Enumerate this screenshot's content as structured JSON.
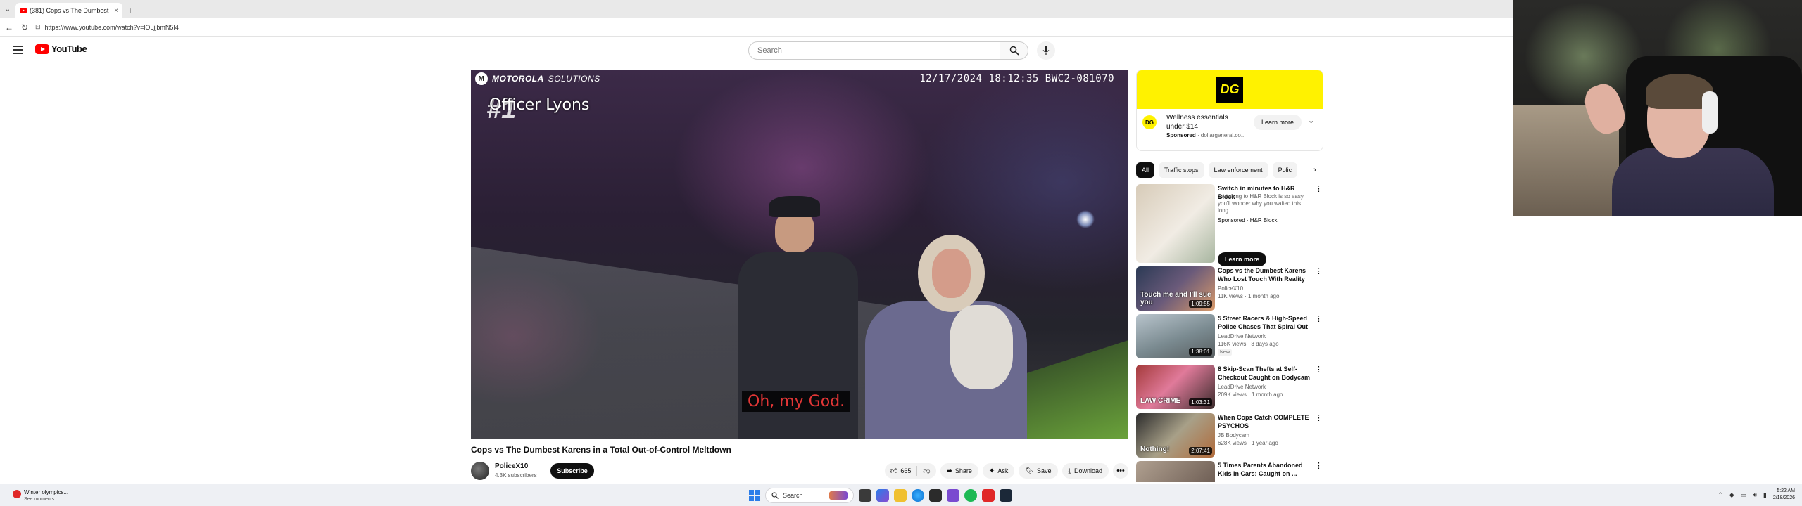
{
  "browser": {
    "tab_title": "(381) Cops vs The Dumbest K...",
    "tab_close": "×",
    "new_tab": "+",
    "url": "https://www.youtube.com/watch?v=lOLjjbmN5I4"
  },
  "youtube": {
    "logo_text": "YouTube",
    "search_placeholder": "Search"
  },
  "player": {
    "brand_bold": "MOTOROLA",
    "brand_regular": "SOLUTIONS",
    "timestamp": "12/17/2024 18:12:35 BWC2-081070",
    "rank_overlay": "#1",
    "officer_name": "Officer Lyons",
    "caption": "Oh, my God."
  },
  "video": {
    "title": "Cops vs The Dumbest Karens in a Total Out-of-Control Meltdown",
    "channel": "PoliceX10",
    "subscribers": "4.3K subscribers",
    "subscribe_label": "Subscribe",
    "likes": "665",
    "share_label": "Share",
    "ask_label": "Ask",
    "save_label": "Save",
    "download_label": "Download",
    "more_label": "•••"
  },
  "sidebar": {
    "ad": {
      "logo": "DG",
      "text": "Wellness essentials under $14",
      "sponsored": "Sponsored",
      "advertiser": "· dollargeneral.co...",
      "learn_more": "Learn more",
      "chevron": "⌄"
    },
    "chips": [
      "All",
      "Traffic stops",
      "Law enforcement",
      "Polic"
    ],
    "chip_next": "›",
    "recs": [
      {
        "title": "Switch in minutes to H&R Block",
        "line1": "Switching to H&R Block is so easy,",
        "line2": "you'll wonder why you waited this",
        "line3": "long.",
        "meta": "Sponsored · H&R Block",
        "button": "Learn more"
      },
      {
        "title": "Cops vs the Dumbest Karens Who Lost Touch With Reality",
        "channel": "PoliceX10",
        "stats": "11K views · 1 month ago",
        "duration": "1:09:55",
        "thumb_text": "Touch me and I'll sue you"
      },
      {
        "title": "5 Street Racers & High-Speed Police Chases That Spiral Out ...",
        "channel": "LeadDrive Network",
        "stats": "116K views · 3 days ago",
        "badge": "New",
        "duration": "1:38:01"
      },
      {
        "title": "8 Skip-Scan Thefts at Self-Checkout Caught on Bodycam",
        "channel": "LeadDrive Network",
        "stats": "209K views · 1 month ago",
        "duration": "1:03:31",
        "thumb_text": "LAW CRIME"
      },
      {
        "title": "When Cops Catch COMPLETE PSYCHOS",
        "channel": "JB Bodycam",
        "stats": "628K views · 1 year ago",
        "duration": "2:07:41",
        "thumb_text": "Nothing!"
      },
      {
        "title": "5 Times Parents Abandoned Kids in Cars: Caught on ..."
      }
    ],
    "dots": "⋮"
  },
  "taskbar": {
    "weather_title": "Winter olympics...",
    "weather_sub": "See moments",
    "search_label": "Search",
    "time": "5:22 AM",
    "date": "2/18/2026"
  }
}
